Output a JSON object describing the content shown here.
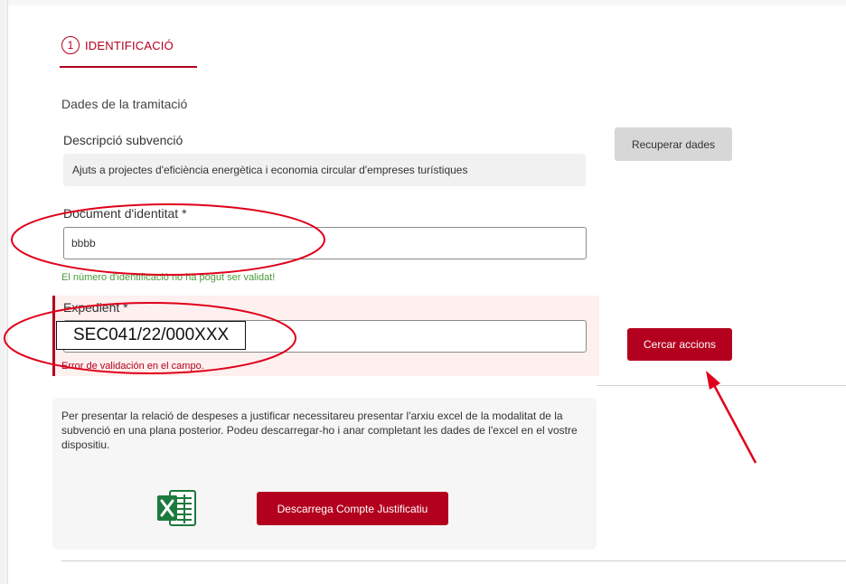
{
  "step": {
    "number": "1",
    "label": "IDENTIFICACIÓ"
  },
  "section": {
    "title": "Dades de la tramitació"
  },
  "descripcio": {
    "label": "Descripció subvenció",
    "value": "Ajuts a projectes d'eficiència energètica i economia circular d'empreses turístiques"
  },
  "recuperar_button": "Recuperar dades",
  "document": {
    "label": "Document d'identitat *",
    "value": "bbbb",
    "message": "El número d'identificació no ha pogut ser validat!"
  },
  "expedient": {
    "label": "Expedient *",
    "value": "",
    "overlay_value": "SEC041/22/000XXX",
    "error": "Error de validación en el campo."
  },
  "cercar_button": "Cercar accions",
  "info": {
    "text": "Per presentar la relació de despeses a justificar necessitareu presentar l'arxiu excel de la modalitat de la subvenció en una plana posterior. Podeu descarregar-ho i anar completant les dades de l'excel en el vostre dispositiu.",
    "icon": "excel-file-icon",
    "download_button": "Descarrega Compte Justificatiu"
  },
  "colors": {
    "brand_red": "#b3001e",
    "annotation_red": "#e0001a",
    "success_green": "#4a9a3a"
  }
}
